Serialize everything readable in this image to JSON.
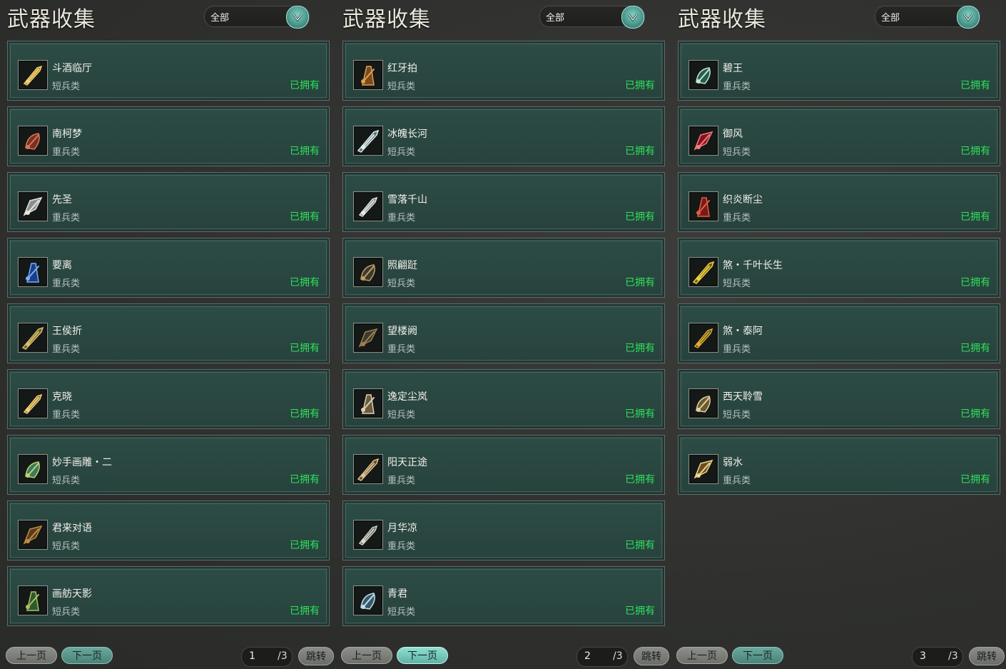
{
  "panels": [
    {
      "title": "武器收集",
      "filter": "全部",
      "prev": "上一页",
      "next": "下一页",
      "page": "1",
      "total": "/3",
      "jump": "跳转",
      "next_highlight": false,
      "items": [
        {
          "name": "斗酒临厅",
          "type": "短兵类",
          "status": "已拥有",
          "icon": "golden-dagger-icon",
          "colors": [
            "#b8862a",
            "#f0d070"
          ]
        },
        {
          "name": "南柯梦",
          "type": "重兵类",
          "status": "已拥有",
          "icon": "red-mace-icon",
          "colors": [
            "#7a2f22",
            "#d07a5a"
          ]
        },
        {
          "name": "先圣",
          "type": "重兵类",
          "status": "已拥有",
          "icon": "silver-axe-icon",
          "colors": [
            "#8a8f90",
            "#e8e8e0"
          ]
        },
        {
          "name": "要离",
          "type": "重兵类",
          "status": "已拥有",
          "icon": "blue-blade-icon",
          "colors": [
            "#1d3c8a",
            "#7ab0f0"
          ]
        },
        {
          "name": "王侯折",
          "type": "重兵类",
          "status": "已拥有",
          "icon": "gold-hilt-icon",
          "colors": [
            "#6b5a2a",
            "#d8c070"
          ]
        },
        {
          "name": "克晓",
          "type": "重兵类",
          "status": "已拥有",
          "icon": "gold-blade-icon",
          "colors": [
            "#8a6a20",
            "#f0d080"
          ]
        },
        {
          "name": "妙手画雕・二",
          "type": "短兵类",
          "status": "已拥有",
          "icon": "jade-dagger-icon",
          "colors": [
            "#3a7a60",
            "#c0d070"
          ]
        },
        {
          "name": "君来对语",
          "type": "短兵类",
          "status": "已拥有",
          "icon": "bronze-dagger-icon",
          "colors": [
            "#5a3a20",
            "#c09040"
          ]
        },
        {
          "name": "画舫天影",
          "type": "短兵类",
          "status": "已拥有",
          "icon": "green-dagger-icon",
          "colors": [
            "#2a5a30",
            "#b0c060"
          ]
        }
      ]
    },
    {
      "title": "武器收集",
      "filter": "全部",
      "prev": "上一页",
      "next": "下一页",
      "page": "2",
      "total": "/3",
      "jump": "跳转",
      "next_highlight": true,
      "items": [
        {
          "name": "红牙拍",
          "type": "短兵类",
          "status": "已拥有",
          "icon": "bronze-cross-icon",
          "colors": [
            "#7a4a20",
            "#e0a050"
          ]
        },
        {
          "name": "冰魄长河",
          "type": "短兵类",
          "status": "已拥有",
          "icon": "ice-dagger-icon",
          "colors": [
            "#5a6a70",
            "#e0f0f0"
          ]
        },
        {
          "name": "雪落千山",
          "type": "重兵类",
          "status": "已拥有",
          "icon": "silver-claws-icon",
          "colors": [
            "#6a7070",
            "#e8e8e8"
          ]
        },
        {
          "name": "照翩跹",
          "type": "短兵类",
          "status": "已拥有",
          "icon": "dark-dagger-icon",
          "colors": [
            "#3a3a30",
            "#c0a060"
          ]
        },
        {
          "name": "望楼阙",
          "type": "重兵类",
          "status": "已拥有",
          "icon": "dark-hilt-icon",
          "colors": [
            "#3a3a30",
            "#a08050"
          ]
        },
        {
          "name": "逸定尘岚",
          "type": "短兵类",
          "status": "已拥有",
          "icon": "steel-blade-icon",
          "colors": [
            "#6a5a40",
            "#e0d0b0"
          ]
        },
        {
          "name": "阳天正途",
          "type": "重兵类",
          "status": "已拥有",
          "icon": "broad-blade-icon",
          "colors": [
            "#5a4a30",
            "#e0c090"
          ]
        },
        {
          "name": "月华凉",
          "type": "重兵类",
          "status": "已拥有",
          "icon": "moon-blade-icon",
          "colors": [
            "#4a4a48",
            "#d8d8d0"
          ]
        },
        {
          "name": "青君",
          "type": "短兵类",
          "status": "已拥有",
          "icon": "blue-claw-icon",
          "colors": [
            "#3a5a6a",
            "#c0e0f0"
          ]
        }
      ]
    },
    {
      "title": "武器收集",
      "filter": "全部",
      "prev": "上一页",
      "next": "下一页",
      "page": "3",
      "total": "/3",
      "jump": "跳转",
      "next_highlight": false,
      "items": [
        {
          "name": "碧王",
          "type": "重兵类",
          "status": "已拥有",
          "icon": "jade-blade-icon",
          "colors": [
            "#2a5a50",
            "#c0e8d0"
          ]
        },
        {
          "name": "御风",
          "type": "短兵类",
          "status": "已拥有",
          "icon": "red-wind-icon",
          "colors": [
            "#8a1020",
            "#f08080"
          ]
        },
        {
          "name": "织炎断尘",
          "type": "重兵类",
          "status": "已拥有",
          "icon": "crimson-blade-icon",
          "colors": [
            "#7a1a18",
            "#e06040"
          ]
        },
        {
          "name": "煞・千叶长生",
          "type": "短兵类",
          "status": "已拥有",
          "icon": "golden-staff-icon",
          "colors": [
            "#6a5a10",
            "#f0d040"
          ]
        },
        {
          "name": "煞・泰阿",
          "type": "重兵类",
          "status": "已拥有",
          "icon": "gold-black-blade-icon",
          "colors": [
            "#3a3010",
            "#e0b030"
          ]
        },
        {
          "name": "西天聆雪",
          "type": "短兵类",
          "status": "已拥有",
          "icon": "ornate-dagger-icon",
          "colors": [
            "#6a5a30",
            "#e0d0a0"
          ]
        },
        {
          "name": "弱水",
          "type": "重兵类",
          "status": "已拥有",
          "icon": "gold-sword-icon",
          "colors": [
            "#6a5020",
            "#f0d890"
          ]
        }
      ]
    }
  ]
}
